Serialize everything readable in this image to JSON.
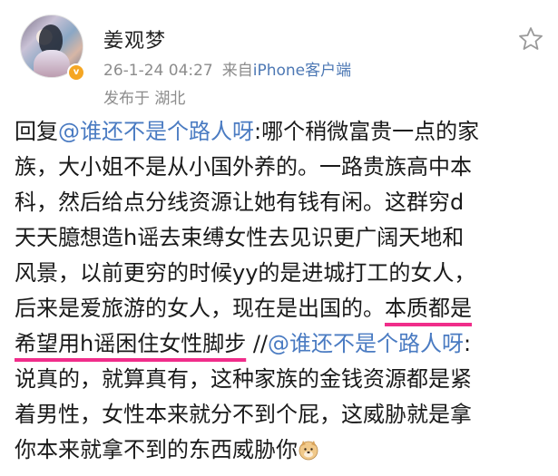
{
  "post": {
    "username": "姜观梦",
    "timestamp": "26-1-24 04:27",
    "source_prefix": "来自",
    "source_app": "iPhone客户端",
    "location": "发布于 湖北",
    "lines": [
      [
        {
          "text": "回复"
        },
        {
          "text": "@谁还不是个路人呀",
          "mention": true
        },
        {
          "text": ":哪个稍微富贵一点的家"
        }
      ],
      [
        {
          "text": "族，大小姐不是从小国外养的。一路贵族高中本"
        }
      ],
      [
        {
          "text": "科，然后给点分线资源让她有钱有闲。这群穷d"
        }
      ],
      [
        {
          "text": "天天臆想造h谣去束缚女性去见识更广阔天地和"
        }
      ],
      [
        {
          "text": "风景，以前更穷的时候yy的是进城打工的女人，"
        }
      ],
      [
        {
          "text": "后来是爱旅游的女人，现在是出国的。"
        },
        {
          "text": "本质都是",
          "mark": true
        }
      ],
      [
        {
          "text": "希望用h谣困住女性脚步",
          "mark": true
        },
        {
          "text": " //"
        },
        {
          "text": "@谁还不是个路人呀",
          "mention": true
        },
        {
          "text": ":"
        }
      ],
      [
        {
          "text": "说真的，就算真有，这种家族的金钱资源都是紧"
        }
      ],
      [
        {
          "text": "着男性，女性本来就分不到个屁，这威胁就是拿"
        }
      ],
      [
        {
          "text": "你本来就拿不到的东西威胁你"
        },
        {
          "emoji": "doge-emoji"
        }
      ]
    ]
  },
  "colors": {
    "mention": "#4a7bc2",
    "highlight_underline": "#f02d8a",
    "verified_badge": "#f5a623",
    "meta_text": "#8c8c8c"
  }
}
